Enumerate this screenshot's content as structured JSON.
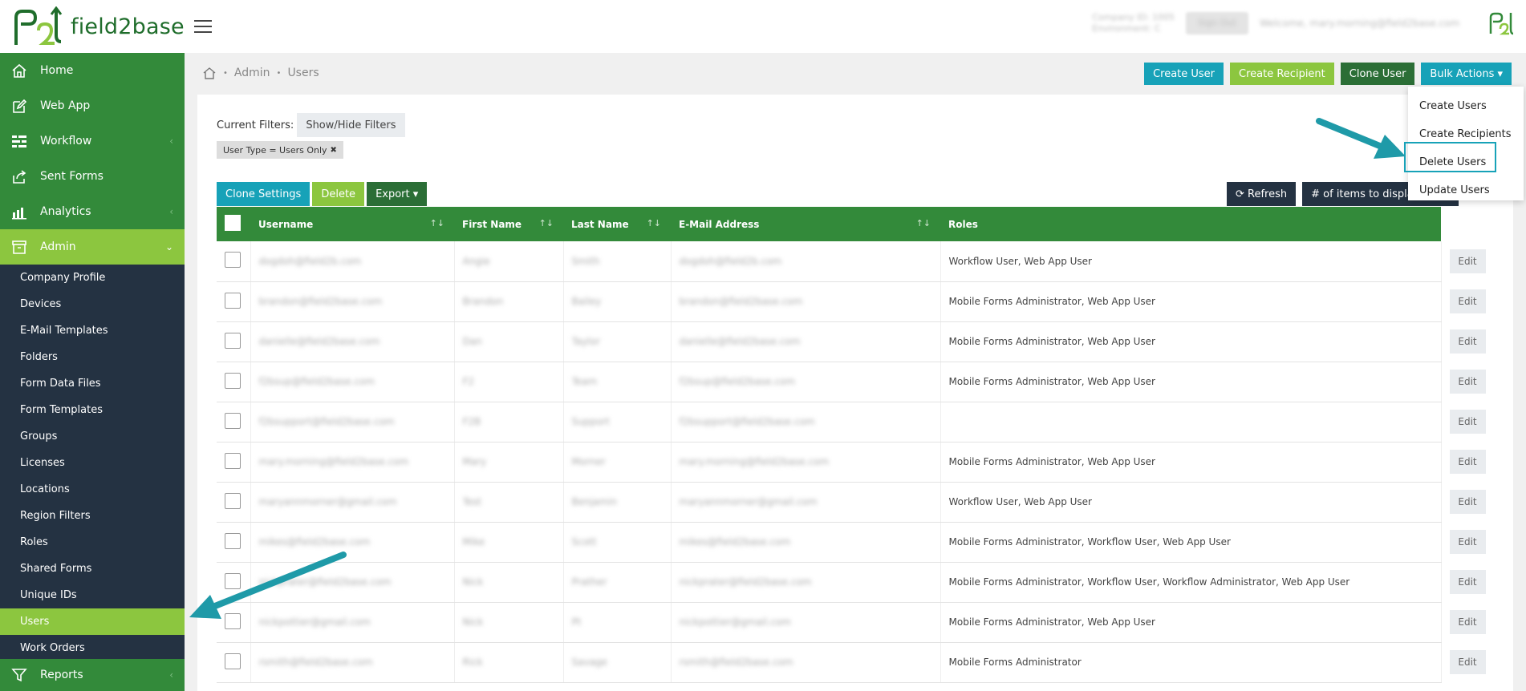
{
  "app": {
    "logo_text": "field2base"
  },
  "topbar": {
    "company_blurred_1": "Company ID: 1005",
    "company_blurred_2": "Environment: C",
    "button_blurred": "Sign Out",
    "welcome_blurred": "Welcome, mary.morning@field2base.com"
  },
  "sidebar": {
    "items": [
      {
        "label": "Home",
        "icon": "home-icon"
      },
      {
        "label": "Web App",
        "icon": "edit-icon"
      },
      {
        "label": "Workflow",
        "icon": "workflow-icon",
        "chevron": "‹"
      },
      {
        "label": "Sent Forms",
        "icon": "share-icon"
      },
      {
        "label": "Analytics",
        "icon": "bar-chart-icon",
        "chevron": "‹"
      },
      {
        "label": "Admin",
        "icon": "archive-icon",
        "chevron": "⌄"
      }
    ],
    "admin_sub_items": [
      "Company Profile",
      "Devices",
      "E-Mail Templates",
      "Folders",
      "Form Data Files",
      "Form Templates",
      "Groups",
      "Licenses",
      "Locations",
      "Region Filters",
      "Roles",
      "Shared Forms",
      "Unique IDs",
      "Users",
      "Work Orders"
    ],
    "bottom_item": {
      "label": "Reports",
      "icon": "filter-icon",
      "chevron": "‹"
    }
  },
  "breadcrumb": {
    "items": [
      "Admin",
      "Users"
    ]
  },
  "header_buttons": {
    "create_user": "Create User",
    "create_recipient": "Create Recipient",
    "clone_user": "Clone User",
    "bulk_actions": "Bulk Actions ▾"
  },
  "bulk_menu": {
    "items": [
      "Create Users",
      "Create Recipients",
      "Delete Users",
      "Update Users"
    ],
    "highlighted": "Delete Users"
  },
  "filters": {
    "label": "Current Filters:",
    "toggle_button": "Show/Hide Filters",
    "chip": "User Type = Users Only",
    "chip_remove": "✖"
  },
  "toolbar": {
    "clone_settings": "Clone Settings",
    "delete": "Delete",
    "export": "Export ▾",
    "refresh": "⟳ Refresh",
    "items_display": "# of items to display:"
  },
  "table": {
    "columns": [
      "Username",
      "First Name",
      "Last Name",
      "E-Mail Address",
      "Roles"
    ],
    "edit_label": "Edit",
    "rows": [
      {
        "username": "dogdoh@field2b.com",
        "first": "Angie",
        "last": "Smith",
        "email": "dogdoh@field2b.com",
        "roles": "Workflow User, Web App User"
      },
      {
        "username": "brandon@field2base.com",
        "first": "Brandon",
        "last": "Bailey",
        "email": "brandon@field2base.com",
        "roles": "Mobile Forms Administrator, Web App User"
      },
      {
        "username": "danielle@field2base.com",
        "first": "Dan",
        "last": "Taylor",
        "email": "danielle@field2base.com",
        "roles": "Mobile Forms Administrator, Web App User"
      },
      {
        "username": "f2bsup@field2base.com",
        "first": "F2",
        "last": "Team",
        "email": "f2bsup@field2base.com",
        "roles": "Mobile Forms Administrator, Web App User"
      },
      {
        "username": "f2bsupport@field2base.com",
        "first": "F2B",
        "last": "Support",
        "email": "f2bsupport@field2base.com",
        "roles": ""
      },
      {
        "username": "mary.morning@field2base.com",
        "first": "Mary",
        "last": "Morner",
        "email": "mary.morning@field2base.com",
        "roles": "Mobile Forms Administrator, Web App User"
      },
      {
        "username": "maryannmorner@gmail.com",
        "first": "Test",
        "last": "Benjamin",
        "email": "maryannmorner@gmail.com",
        "roles": "Workflow User, Web App User"
      },
      {
        "username": "mikes@field2base.com",
        "first": "Mike",
        "last": "Scott",
        "email": "mikes@field2base.com",
        "roles": "Mobile Forms Administrator, Workflow User, Web App User"
      },
      {
        "username": "nickprater@field2base.com",
        "first": "Nick",
        "last": "Prather",
        "email": "nickprater@field2base.com",
        "roles": "Mobile Forms Administrator, Workflow User, Workflow Administrator, Web App User"
      },
      {
        "username": "nickpottier@gmail.com",
        "first": "Nick",
        "last": "Pt",
        "email": "nickpottier@gmail.com",
        "roles": "Mobile Forms Administrator, Web App User"
      },
      {
        "username": "rsmith@field2base.com",
        "first": "Rick",
        "last": "Savage",
        "email": "rsmith@field2base.com",
        "roles": "Mobile Forms Administrator"
      }
    ]
  },
  "colors": {
    "green_dark": "#338a3a",
    "green_lime": "#8cc63f",
    "teal": "#17a2b8",
    "navy": "#243242",
    "clone_green": "#2b6e36"
  }
}
